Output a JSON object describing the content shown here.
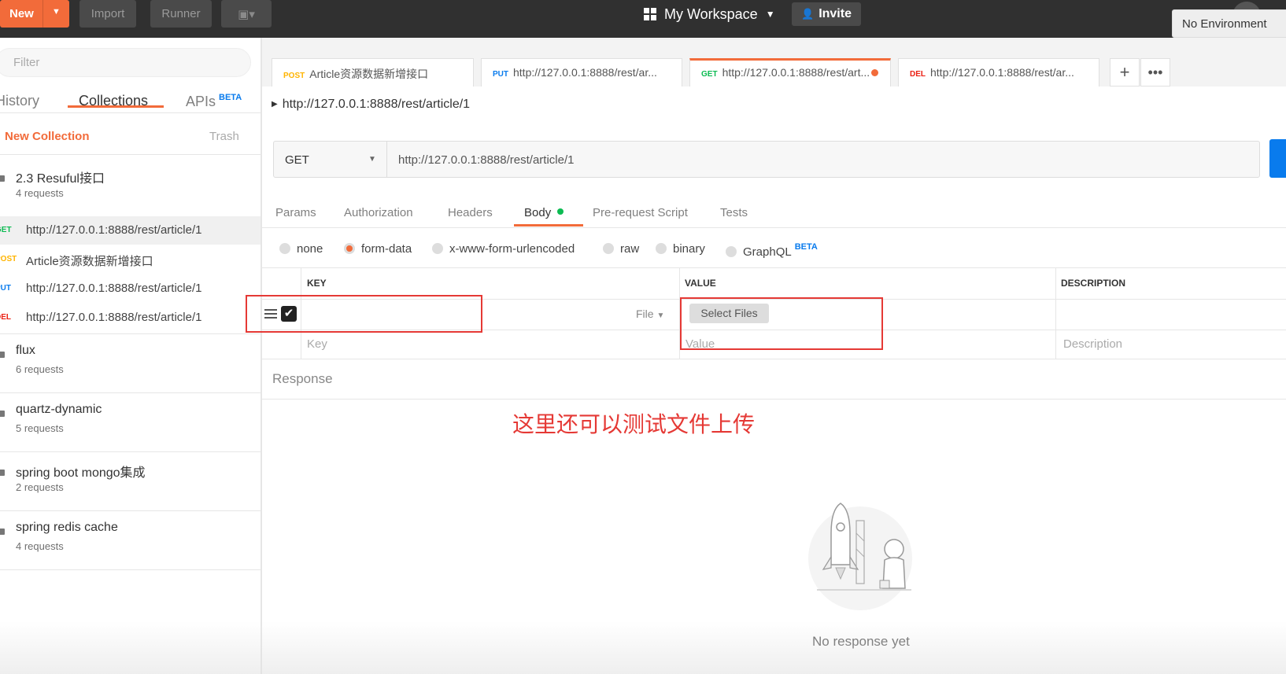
{
  "topbar": {
    "new_label": "New",
    "import_label": "Import",
    "runner_label": "Runner",
    "workspace_label": "My Workspace",
    "invite_label": "Invite"
  },
  "sidebar": {
    "filter_placeholder": "Filter",
    "tabs": [
      "History",
      "Collections",
      "APIs"
    ],
    "apis_badge": "BETA",
    "new_collection": "New Collection",
    "trash": "Trash",
    "collections": [
      {
        "name": "2.3 Resuful接口",
        "count": "4 requests"
      },
      {
        "name": "flux",
        "count": "6 requests"
      },
      {
        "name": "quartz-dynamic",
        "count": "5 requests"
      },
      {
        "name": "spring boot mongo集成",
        "count": "2 requests"
      },
      {
        "name": "spring redis cache",
        "count": "4 requests"
      }
    ],
    "requests": [
      {
        "method": "GET",
        "title": "http://127.0.0.1:8888/rest/article/1",
        "color": "#0cbb52"
      },
      {
        "method": "POST",
        "title": "Article资源数据新增接口",
        "color": "#ffb400"
      },
      {
        "method": "PUT",
        "title": "http://127.0.0.1:8888/rest/article/1",
        "color": "#097bed"
      },
      {
        "method": "DEL",
        "title": "http://127.0.0.1:8888/rest/article/1",
        "color": "#eb2013"
      }
    ]
  },
  "tabs": [
    {
      "method": "POST",
      "title": "Article资源数据新增接口",
      "color": "#ffb400"
    },
    {
      "method": "PUT",
      "title": "http://127.0.0.1:8888/rest/ar...",
      "color": "#097bed"
    },
    {
      "method": "GET",
      "title": "http://127.0.0.1:8888/rest/art...",
      "color": "#0cbb52"
    },
    {
      "method": "DEL",
      "title": "http://127.0.0.1:8888/rest/ar...",
      "color": "#eb2013"
    }
  ],
  "environment": "No Environment",
  "request": {
    "title": "http://127.0.0.1:8888/rest/article/1",
    "method": "GET",
    "url": "http://127.0.0.1:8888/rest/article/1"
  },
  "subtabs": [
    "Params",
    "Authorization",
    "Headers",
    "Body",
    "Pre-request Script",
    "Tests"
  ],
  "body_types": [
    "none",
    "form-data",
    "x-www-form-urlencoded",
    "raw",
    "binary",
    "GraphQL"
  ],
  "graphql_badge": "BETA",
  "form_table": {
    "headers": [
      "KEY",
      "VALUE",
      "DESCRIPTION"
    ],
    "row_type": "File",
    "select_files": "Select Files",
    "key_placeholder": "Key",
    "value_placeholder": "Value",
    "description_placeholder": "Description"
  },
  "response": {
    "label": "Response",
    "empty_text": "No response yet"
  },
  "annotation": "这里还可以测试文件上传",
  "colors": {
    "accent": "#f26b3a",
    "annotation": "#e53935",
    "send": "#097bed"
  }
}
